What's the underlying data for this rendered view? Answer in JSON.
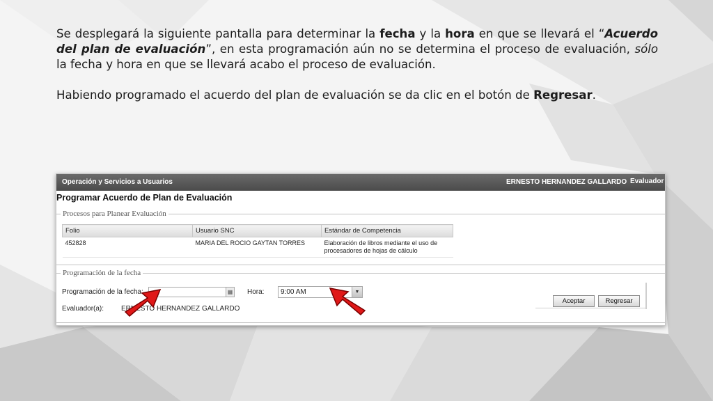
{
  "slide": {
    "p1_pre": "Se desplegará la siguiente pantalla para determinar la ",
    "p1_bold_fecha": "fecha",
    "p1_y_la": " y la ",
    "p1_bold_hora": "hora",
    "p1_mid": " en que se llevará el “",
    "p1_bold_italic": "Acuerdo del plan de evaluación",
    "p1_after": "”, en esta programación aún no se determina el proceso de evaluación, ",
    "p1_italic": "sólo",
    "p1_end": " la fecha y hora en que se llevará acabo el proceso de evaluación.",
    "p2_pre": "Habiendo programado el acuerdo del plan de evaluación se da clic en el botón de ",
    "p2_bold": "Regresar",
    "p2_end": "."
  },
  "app": {
    "topbar_left": "Operación y Servicios a Usuarios",
    "user_name": "ERNESTO HERNANDEZ GALLARDO",
    "role": "Evaluador",
    "page_title": "Programar Acuerdo de Plan de Evaluación",
    "section1_legend": "Procesos para Planear Evaluación",
    "table_headers": [
      "Folio",
      "Usuario SNC",
      "Estándar de Competencia"
    ],
    "table_rows": [
      {
        "folio": "452828",
        "usuario": "MARIA DEL ROCIO GAYTAN TORRES",
        "estandar": "Elaboración de libros mediante el uso de procesadores de hojas de cálculo"
      }
    ],
    "section2_legend": "Programación de la fecha",
    "fecha_label": "Programación de la fecha:",
    "fecha_value": "",
    "hora_label": "Hora:",
    "hora_value": "9:00 AM",
    "evaluador_label": "Evaluador(a):",
    "evaluador_value": "ERNESTO HERNANDEZ GALLARDO",
    "aceptar_label": "Aceptar",
    "regresar_label": "Regresar",
    "calendar_icon": "calendar-icon",
    "dropdown_icon": "chevron-down-icon"
  },
  "colors": {
    "topbar": "#555555",
    "annotation_arrow": "#e01818"
  }
}
